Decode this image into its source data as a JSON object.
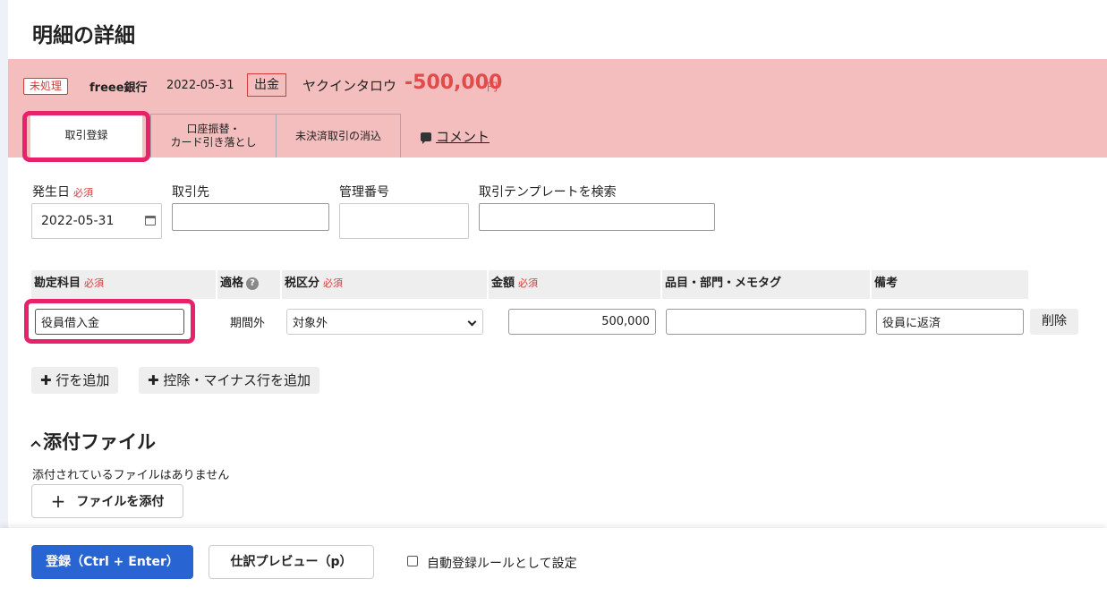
{
  "page": {
    "title": "明細の詳細"
  },
  "banner": {
    "status_badge": "未処理",
    "bank": "freee銀行",
    "date": "2022-05-31",
    "type": "出金",
    "payee": "ヤクインタロウ",
    "amount": "-500,000",
    "currency": "円",
    "background": "#f5bebe",
    "amount_color": "#e04b4b"
  },
  "tabs": {
    "register": "取引登録",
    "transfer_line1": "口座振替・",
    "transfer_line2": "カード引き落とし",
    "settle": "未決済取引の消込",
    "comment": "コメント"
  },
  "form": {
    "required": "必須",
    "date_label": "発生日",
    "date_value": "2022-05-31",
    "partner_label": "取引先",
    "partner_value": "",
    "ref_label": "管理番号",
    "ref_value": "",
    "template_label": "取引テンプレートを検索",
    "template_value": ""
  },
  "table": {
    "headers": {
      "account": "勘定科目",
      "eligibility": "適格",
      "tax": "税区分",
      "amount": "金額",
      "tags": "品目・部門・メモタグ",
      "note": "備考"
    },
    "row": {
      "account": "役員借入金",
      "period": "期間外",
      "tax": "対象外",
      "amount": "500,000",
      "tags": "",
      "note": "役員に返済",
      "delete": "削除"
    }
  },
  "actions": {
    "add_row": "行を追加",
    "add_deduct_row": "控除・マイナス行を追加"
  },
  "attachments": {
    "title": "添付ファイル",
    "empty": "添付されているファイルはありません",
    "attach_button": "ファイルを添付"
  },
  "footer": {
    "register": "登録（Ctrl + Enter）",
    "preview": "仕訳プレビュー（p）",
    "auto_rule": "自動登録ルールとして設定",
    "primary_color": "#2864d2"
  },
  "highlight_color": "#e8226a"
}
